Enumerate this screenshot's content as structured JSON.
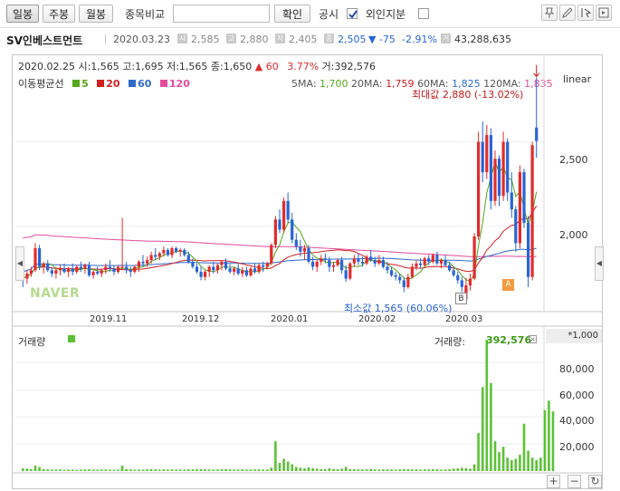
{
  "toolbar": {
    "tabs": [
      "일봉",
      "주봉",
      "월봉"
    ],
    "compare_label": "종목비교",
    "compare_placeholder": "",
    "confirm_label": "확인",
    "disclosure_label": "공시",
    "foreign_label": "외인지분"
  },
  "info": {
    "name": "SV인베스트먼트",
    "date": "2020.03.23",
    "open": "2,585",
    "high": "2,880",
    "low": "2,405",
    "close": "2,505",
    "change": "▼ -75",
    "change_pct": "-2.91%",
    "volume": "43,288,635",
    "label_open": "시",
    "label_high": "고",
    "label_low": "저",
    "label_volume": "거"
  },
  "detail": {
    "date": "2020.02.25",
    "text": "시:1,565 고:1,695 저:1,565 종:1,650",
    "change": "▲ 60",
    "pct": "3.77%",
    "vol": "거:392,576"
  },
  "ma": {
    "legend_title": "이동평균선",
    "items": [
      {
        "label": "5",
        "color": "#53a81b"
      },
      {
        "label": "20",
        "color": "#d21f1f"
      },
      {
        "label": "60",
        "color": "#2f69c9"
      },
      {
        "label": "120",
        "color": "#e34b9d"
      }
    ],
    "right": [
      {
        "label": "5MA:",
        "value": "1,700",
        "color": "#53a81b"
      },
      {
        "label": "20MA:",
        "value": "1,759",
        "color": "#d21f1f"
      },
      {
        "label": "60MA:",
        "value": "1,825",
        "color": "#2f69c9"
      },
      {
        "label": "120MA:",
        "value": "1,835",
        "color": "#e34b9d"
      }
    ]
  },
  "scale_label": "linear",
  "max_annot": "최대값 2,880 (-13.02%)",
  "min_annot": "최소값 1,565 (60.06%)",
  "watermark": "NAVER",
  "price_ticks": [
    "2,500",
    "2,000"
  ],
  "x_ticks": [
    "2019.11",
    "2019.12",
    "2020.01",
    "2020.02",
    "2020.03"
  ],
  "volume": {
    "label": "거래량",
    "value_label": "거래량:",
    "value": "392,576",
    "unit": "*1,000",
    "ticks": [
      "80,000",
      "60,000",
      "40,000",
      "20,000"
    ]
  },
  "badges": {
    "b": "B",
    "a": "A"
  },
  "colors": {
    "up": "#e22b2b",
    "down": "#2a64d6",
    "volume": "#5bc236"
  },
  "chart_data": {
    "type": "candlestick",
    "price_ylim": [
      1500,
      2900
    ],
    "volume_ylim": [
      0,
      95000
    ],
    "candles": [
      [
        1780,
        1800,
        1640,
        1690
      ],
      [
        1690,
        1740,
        1660,
        1720
      ],
      [
        1720,
        1760,
        1700,
        1740
      ],
      [
        1740,
        1900,
        1730,
        1870
      ],
      [
        1870,
        1890,
        1740,
        1760
      ],
      [
        1760,
        1790,
        1720,
        1780
      ],
      [
        1780,
        1800,
        1730,
        1740
      ],
      [
        1740,
        1760,
        1700,
        1720
      ],
      [
        1720,
        1760,
        1690,
        1740
      ],
      [
        1740,
        1770,
        1710,
        1750
      ],
      [
        1750,
        1780,
        1720,
        1730
      ],
      [
        1730,
        1760,
        1700,
        1750
      ],
      [
        1750,
        1780,
        1710,
        1730
      ],
      [
        1730,
        1770,
        1720,
        1760
      ],
      [
        1760,
        1790,
        1730,
        1750
      ],
      [
        1750,
        1780,
        1720,
        1770
      ],
      [
        1770,
        1790,
        1700,
        1710
      ],
      [
        1710,
        1740,
        1690,
        1730
      ],
      [
        1730,
        1760,
        1710,
        1720
      ],
      [
        1720,
        1750,
        1700,
        1740
      ],
      [
        1740,
        1780,
        1720,
        1760
      ],
      [
        1760,
        1800,
        1730,
        1750
      ],
      [
        1750,
        1770,
        1710,
        1730
      ],
      [
        1730,
        1770,
        1720,
        1760
      ],
      [
        1760,
        2050,
        1740,
        1760
      ],
      [
        1760,
        1790,
        1720,
        1740
      ],
      [
        1740,
        1760,
        1700,
        1730
      ],
      [
        1730,
        1770,
        1720,
        1760
      ],
      [
        1760,
        1800,
        1730,
        1790
      ],
      [
        1790,
        1830,
        1760,
        1780
      ],
      [
        1780,
        1820,
        1760,
        1800
      ],
      [
        1800,
        1850,
        1780,
        1830
      ],
      [
        1830,
        1870,
        1800,
        1820
      ],
      [
        1820,
        1850,
        1800,
        1840
      ],
      [
        1840,
        1880,
        1820,
        1860
      ],
      [
        1860,
        1870,
        1820,
        1830
      ],
      [
        1830,
        1880,
        1810,
        1870
      ],
      [
        1870,
        1880,
        1840,
        1850
      ],
      [
        1850,
        1870,
        1820,
        1860
      ],
      [
        1860,
        1870,
        1820,
        1830
      ],
      [
        1830,
        1850,
        1780,
        1790
      ],
      [
        1790,
        1810,
        1750,
        1760
      ],
      [
        1760,
        1780,
        1720,
        1730
      ],
      [
        1730,
        1760,
        1680,
        1700
      ],
      [
        1700,
        1740,
        1680,
        1730
      ],
      [
        1730,
        1770,
        1700,
        1760
      ],
      [
        1760,
        1790,
        1720,
        1740
      ],
      [
        1740,
        1780,
        1720,
        1770
      ],
      [
        1770,
        1800,
        1740,
        1790
      ],
      [
        1790,
        1810,
        1740,
        1750
      ],
      [
        1750,
        1780,
        1720,
        1730
      ],
      [
        1730,
        1760,
        1710,
        1750
      ],
      [
        1750,
        1780,
        1710,
        1720
      ],
      [
        1720,
        1760,
        1700,
        1740
      ],
      [
        1740,
        1760,
        1700,
        1710
      ],
      [
        1710,
        1760,
        1700,
        1750
      ],
      [
        1750,
        1780,
        1720,
        1730
      ],
      [
        1730,
        1780,
        1720,
        1770
      ],
      [
        1770,
        1790,
        1730,
        1760
      ],
      [
        1760,
        1790,
        1750,
        1780
      ],
      [
        1780,
        1900,
        1770,
        1890
      ],
      [
        1890,
        2060,
        1870,
        2040
      ],
      [
        2040,
        2100,
        1960,
        1980
      ],
      [
        1980,
        2170,
        1960,
        2150
      ],
      [
        2150,
        2200,
        2020,
        2040
      ],
      [
        2040,
        2080,
        1900,
        1920
      ],
      [
        1920,
        1960,
        1860,
        1880
      ],
      [
        1880,
        1920,
        1820,
        1850
      ],
      [
        1850,
        1890,
        1800,
        1870
      ],
      [
        1870,
        1890,
        1780,
        1790
      ],
      [
        1790,
        1820,
        1740,
        1760
      ],
      [
        1760,
        1800,
        1730,
        1790
      ],
      [
        1790,
        1830,
        1770,
        1810
      ],
      [
        1810,
        1840,
        1780,
        1800
      ],
      [
        1800,
        1820,
        1730,
        1760
      ],
      [
        1760,
        1790,
        1730,
        1770
      ],
      [
        1770,
        1810,
        1760,
        1800
      ],
      [
        1800,
        1820,
        1720,
        1740
      ],
      [
        1740,
        1770,
        1670,
        1690
      ],
      [
        1690,
        1790,
        1680,
        1780
      ],
      [
        1780,
        1830,
        1760,
        1810
      ],
      [
        1810,
        1840,
        1770,
        1790
      ],
      [
        1790,
        1820,
        1760,
        1780
      ],
      [
        1780,
        1830,
        1770,
        1820
      ],
      [
        1820,
        1860,
        1790,
        1800
      ],
      [
        1800,
        1820,
        1760,
        1780
      ],
      [
        1780,
        1830,
        1770,
        1800
      ],
      [
        1800,
        1820,
        1750,
        1760
      ],
      [
        1760,
        1790,
        1720,
        1740
      ],
      [
        1740,
        1760,
        1700,
        1710
      ],
      [
        1710,
        1730,
        1680,
        1700
      ],
      [
        1700,
        1720,
        1660,
        1680
      ],
      [
        1680,
        1700,
        1610,
        1640
      ],
      [
        1640,
        1720,
        1630,
        1700
      ],
      [
        1700,
        1780,
        1690,
        1760
      ],
      [
        1760,
        1800,
        1740,
        1780
      ],
      [
        1780,
        1810,
        1750,
        1770
      ],
      [
        1770,
        1820,
        1760,
        1810
      ],
      [
        1810,
        1830,
        1770,
        1790
      ],
      [
        1790,
        1840,
        1780,
        1830
      ],
      [
        1830,
        1850,
        1770,
        1780
      ],
      [
        1780,
        1810,
        1750,
        1800
      ],
      [
        1800,
        1830,
        1760,
        1770
      ],
      [
        1770,
        1790,
        1730,
        1740
      ],
      [
        1740,
        1760,
        1700,
        1710
      ],
      [
        1710,
        1730,
        1660,
        1680
      ],
      [
        1680,
        1700,
        1610,
        1640
      ],
      [
        1565,
        1695,
        1565,
        1650
      ],
      [
        1650,
        1720,
        1620,
        1690
      ],
      [
        1690,
        1960,
        1680,
        1940
      ],
      [
        1940,
        2560,
        1920,
        2500
      ],
      [
        2500,
        2620,
        2260,
        2320
      ],
      [
        2320,
        2600,
        2280,
        2540
      ],
      [
        2540,
        2580,
        2100,
        2150
      ],
      [
        2150,
        2450,
        2120,
        2400
      ],
      [
        2400,
        2420,
        2120,
        2180
      ],
      [
        2180,
        2560,
        2150,
        2500
      ],
      [
        2500,
        2520,
        2150,
        2200
      ],
      [
        2200,
        2320,
        2050,
        2100
      ],
      [
        2100,
        2120,
        1850,
        1900
      ],
      [
        1900,
        2360,
        1870,
        2320
      ],
      [
        2320,
        2340,
        1990,
        2020
      ],
      [
        2020,
        2060,
        1640,
        1700
      ],
      [
        1700,
        2500,
        1680,
        2480
      ],
      [
        2585,
        2880,
        2405,
        2505
      ]
    ],
    "volumes": [
      2000,
      1800,
      1500,
      4000,
      3000,
      1500,
      1200,
      1000,
      1100,
      1200,
      900,
      1000,
      1100,
      900,
      1000,
      1200,
      1300,
      1100,
      1000,
      1100,
      1200,
      1000,
      900,
      1100,
      4000,
      1500,
      1200,
      1000,
      1200,
      1100,
      1300,
      1500,
      1200,
      1100,
      1300,
      1100,
      1200,
      1000,
      1100,
      1000,
      1200,
      1300,
      1400,
      1500,
      1300,
      1200,
      1100,
      1200,
      1300,
      1500,
      1200,
      1000,
      1100,
      1200,
      1100,
      1000,
      1200,
      1300,
      1100,
      1200,
      2500,
      22000,
      6000,
      9000,
      7000,
      5000,
      3000,
      2500,
      2000,
      2800,
      2200,
      1800,
      1500,
      1400,
      2000,
      1600,
      1500,
      1800,
      3000,
      1500,
      1400,
      1300,
      1200,
      1300,
      1500,
      1200,
      1100,
      1300,
      1200,
      1100,
      1000,
      1200,
      1500,
      1400,
      1300,
      1200,
      1100,
      1300,
      1200,
      1400,
      1300,
      1100,
      1200,
      1400,
      1800,
      2000,
      2500,
      2200,
      1800,
      5000,
      28000,
      62000,
      97000,
      65000,
      22000,
      14000,
      18000,
      10000,
      8000,
      9000,
      12000,
      35000,
      15000,
      10000,
      8000,
      10000,
      45000,
      52000,
      44000
    ],
    "xlabel": "",
    "ylabel": ""
  }
}
